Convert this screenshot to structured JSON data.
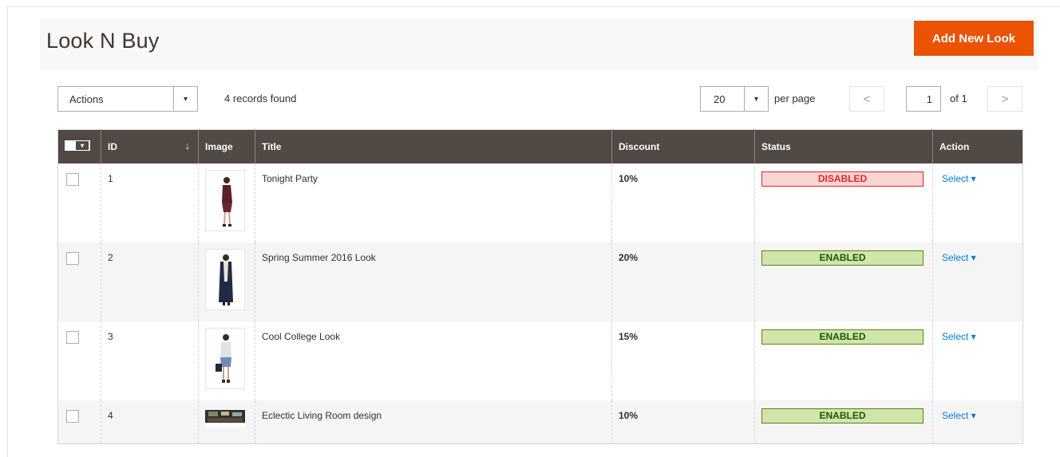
{
  "page": {
    "title": "Look N Buy",
    "add_button": "Add New Look"
  },
  "toolbar": {
    "actions_label": "Actions",
    "records_found": "4 records found",
    "per_page_value": "20",
    "per_page_label": "per page",
    "current_page": "1",
    "of_pages": "of 1",
    "prev_symbol": "<",
    "next_symbol": ">",
    "dropdown_symbol": "▾"
  },
  "grid": {
    "headers": {
      "id": "ID",
      "image": "Image",
      "title": "Title",
      "discount": "Discount",
      "status": "Status",
      "action": "Action"
    },
    "sort_symbol": "↓",
    "rows": [
      {
        "id": "1",
        "title": "Tonight Party",
        "discount": "10%",
        "status": "DISABLED",
        "status_type": "disabled",
        "action": "Select ▾",
        "image_icon": "model-maroon-dress-thumbnail"
      },
      {
        "id": "2",
        "title": "Spring Summer 2016 Look",
        "discount": "20%",
        "status": "ENABLED",
        "status_type": "enabled",
        "action": "Select ▾",
        "image_icon": "model-long-coat-thumbnail"
      },
      {
        "id": "3",
        "title": "Cool College Look",
        "discount": "15%",
        "status": "ENABLED",
        "status_type": "enabled",
        "action": "Select ▾",
        "image_icon": "model-casual-thumbnail"
      },
      {
        "id": "4",
        "title": "Eclectic Living Room design",
        "discount": "10%",
        "status": "ENABLED",
        "status_type": "enabled",
        "action": "Select ▾",
        "image_icon": "living-room-thumbnail"
      }
    ]
  },
  "colors": {
    "accent": "#eb5202",
    "header_bg": "#514943",
    "link": "#007bdb",
    "disabled": "#e22626",
    "enabled_bg": "#d0e5a9"
  }
}
